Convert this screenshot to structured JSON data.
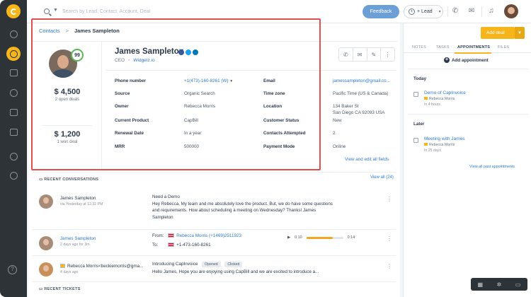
{
  "search": {
    "placeholder": "Search by Lead, Contact, Account, Deal"
  },
  "header": {
    "feedback_label": "Feedback",
    "lead_label": "Lead"
  },
  "breadcrumb": {
    "root": "Contacts",
    "separator": ">",
    "current": "James Sampleton"
  },
  "contact": {
    "name": "James Sampleton",
    "role": "CEO",
    "company": "Widgetz.io",
    "score": "99",
    "open_deals_amount": "$ 4,500",
    "open_deals_label": "2 open deals",
    "won_deals_amount": "$ 1,200",
    "won_deals_label": "1 won deal"
  },
  "fields_left": [
    {
      "label": "Phone number",
      "value": "+1(473)-160-8261 (W)"
    },
    {
      "label": "Source",
      "value": "Organic Search"
    },
    {
      "label": "Owner",
      "value": "Rebecca Morris"
    },
    {
      "label": "Current Product",
      "value": "CapBill"
    },
    {
      "label": "Renewal Date",
      "value": "In a year"
    },
    {
      "label": "MRR",
      "value": "500000"
    }
  ],
  "fields_right": [
    {
      "label": "Email",
      "value": "jamessampleton@gmail.co..."
    },
    {
      "label": "Time zone",
      "value": "Pacific Time (US & Canada)"
    },
    {
      "label": "Location",
      "value": "134 Baker St",
      "value2": "San Diego CA 92093 USA"
    },
    {
      "label": "Customer Status",
      "value": "New"
    },
    {
      "label": "Contacts Attempted",
      "value": "2"
    },
    {
      "label": "Payment Mode",
      "value": "Online"
    }
  ],
  "view_all_fields": "View and edit all fields",
  "conversations": {
    "heading": "RECENT CONVERSATIONS",
    "view_all": "View all (24)",
    "items": [
      {
        "who": "James Sampleton",
        "when": "via Yesterday at 12:32 PM",
        "subject": "Need a Demo",
        "body": "Hey Rebecca, My team and me absolutely love the product. But, we do have some questions and requirements. How about scheduling a meeting on Wednesday? Thanks! James Sampleton"
      },
      {
        "who": "James Sampleton",
        "when": "2 days ago for 3m",
        "from_label": "From:",
        "from_value": "Rebecca Morris (+1469)2511923",
        "to_label": "To:",
        "to_value": "+1-473-160-8261",
        "time_start": "0:10",
        "time_end": "0:14",
        "progress": 0.72
      },
      {
        "who": "Rebecca Morris<beckiemorris@gma...",
        "when": "4 days ago",
        "subject": "Introducing CapInvoice",
        "tag1": "Opened",
        "tag2": "Clicked",
        "body": "Hello James, Hope you are enjoying using CapBill and we are excited to introduce a..."
      }
    ]
  },
  "tickets_heading": "RECENT TICKETS",
  "right_panel": {
    "add_deal": "Add deal",
    "tabs": [
      "NOTES",
      "TASKS",
      "APPOINTMENTS",
      "FILES"
    ],
    "active_tab": "APPOINTMENTS",
    "add_appointment": "Add appointment",
    "today_label": "Today",
    "later_label": "Later",
    "appointments": [
      {
        "title": "Demo of CapInvoice",
        "owner": "Rebecca Morris",
        "time": "In 4 hours"
      },
      {
        "title": "Meeting with James",
        "owner": "Rebecca Morris",
        "time": "In 25 days"
      }
    ],
    "view_past": "View all past appointments"
  },
  "colors": {
    "accent": "#f5b51b",
    "link": "#2e7bd0",
    "highlight": "#e04f4f",
    "nav_bg": "#2e3338"
  }
}
